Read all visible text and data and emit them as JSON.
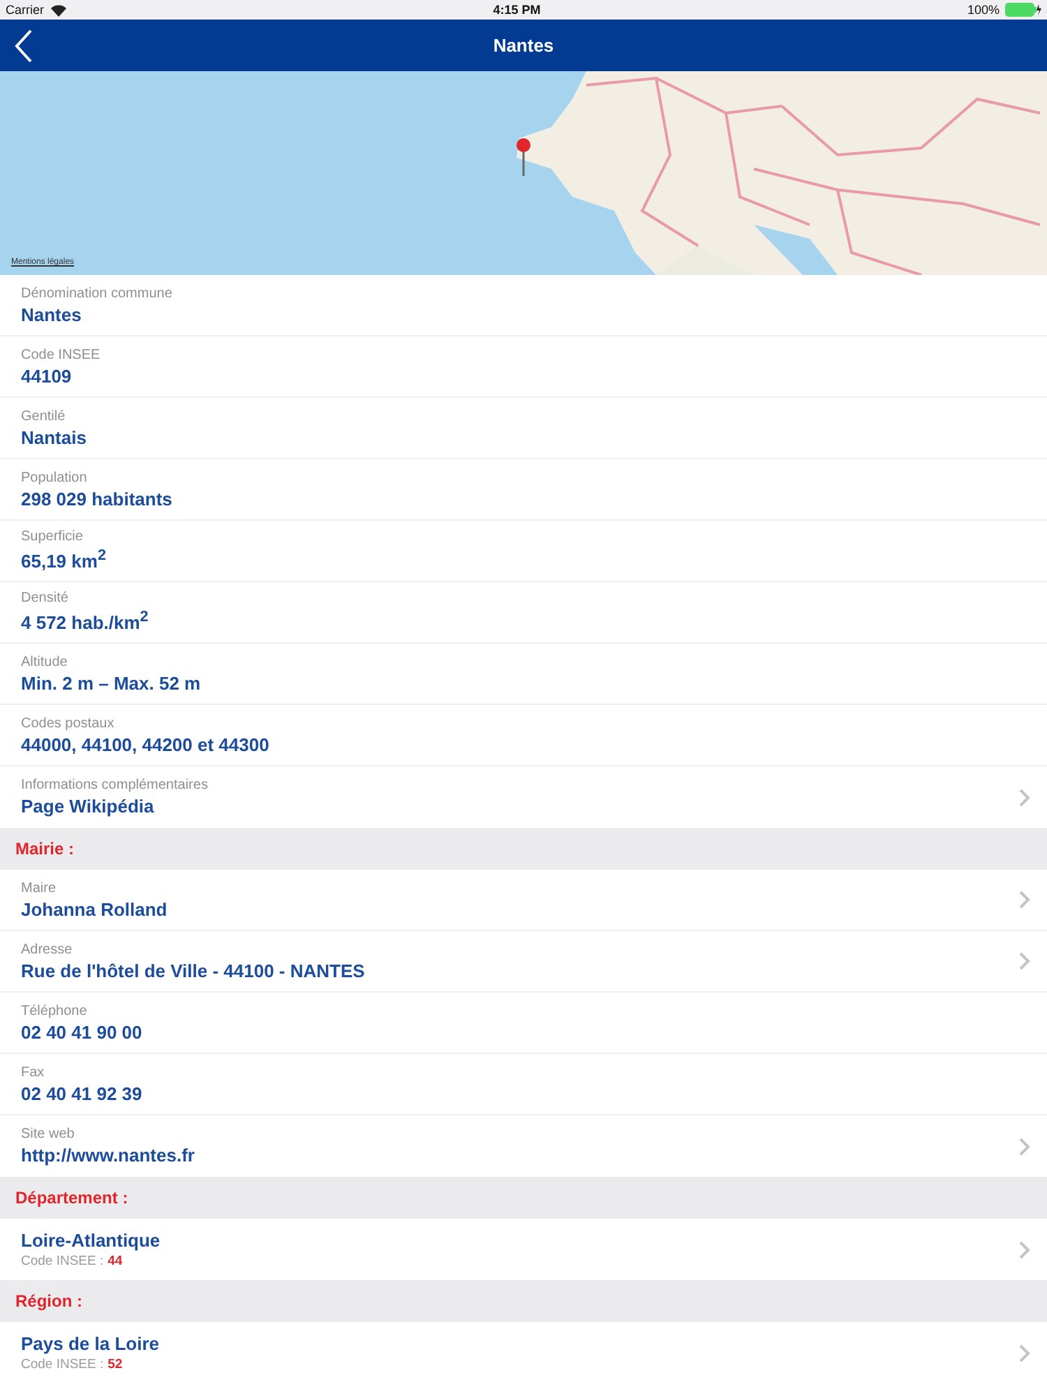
{
  "status_bar": {
    "carrier": "Carrier",
    "time": "4:15 PM",
    "battery": "100%"
  },
  "nav_bar": {
    "title": "Nantes"
  },
  "map": {
    "kind": "picture",
    "legal_link": "Mentions légales"
  },
  "sections": [
    {
      "rows": [
        {
          "kind": "field",
          "label": "Dénomination commune",
          "value": "Nantes",
          "chevron": false
        },
        {
          "kind": "field",
          "label": "Code INSEE",
          "value": "44109",
          "chevron": false
        },
        {
          "kind": "field",
          "label": "Gentilé",
          "value": "Nantais",
          "chevron": false
        },
        {
          "kind": "field",
          "label": "Population",
          "value": "298 029 habitants",
          "chevron": false
        },
        {
          "kind": "field",
          "label": "Superficie",
          "value": "65,19 km$^{2}$",
          "chevron": false
        },
        {
          "kind": "field",
          "label": "Densité",
          "value": "4 572 hab./km$^{2}$",
          "chevron": false
        },
        {
          "kind": "field",
          "label": "Altitude",
          "value": "Min. 2 m – Max. 52 m",
          "chevron": false
        },
        {
          "kind": "field",
          "label": "Codes postaux",
          "value": "44000, 44100, 44200 et 44300",
          "chevron": false
        },
        {
          "kind": "field",
          "label": "Informations complémentaires",
          "value": "Page Wikipédia",
          "chevron": true
        }
      ]
    },
    {
      "header": "Mairie :",
      "rows": [
        {
          "kind": "field",
          "label": "Maire",
          "value": "Johanna Rolland",
          "chevron": true
        },
        {
          "kind": "field",
          "label": "Adresse",
          "value": "Rue de l'hôtel de Ville - 44100 - NANTES",
          "chevron": true
        },
        {
          "kind": "field",
          "label": "Téléphone",
          "value": "02 40 41 90 00",
          "chevron": false
        },
        {
          "kind": "field",
          "label": "Fax",
          "value": "02 40 41 92 39",
          "chevron": false
        },
        {
          "kind": "field",
          "label": "Site web",
          "value": "http://www.nantes.fr",
          "chevron": true
        }
      ]
    },
    {
      "header": "Département :",
      "rows": [
        {
          "kind": "entity",
          "name": "Loire-Atlantique",
          "code_label": "Code INSEE :",
          "code": "44",
          "chevron": true
        }
      ]
    },
    {
      "header": "Région :",
      "rows": [
        {
          "kind": "entity",
          "name": "Pays de la Loire",
          "code_label": "Code INSEE :",
          "code": "52",
          "chevron": true
        }
      ]
    }
  ]
}
